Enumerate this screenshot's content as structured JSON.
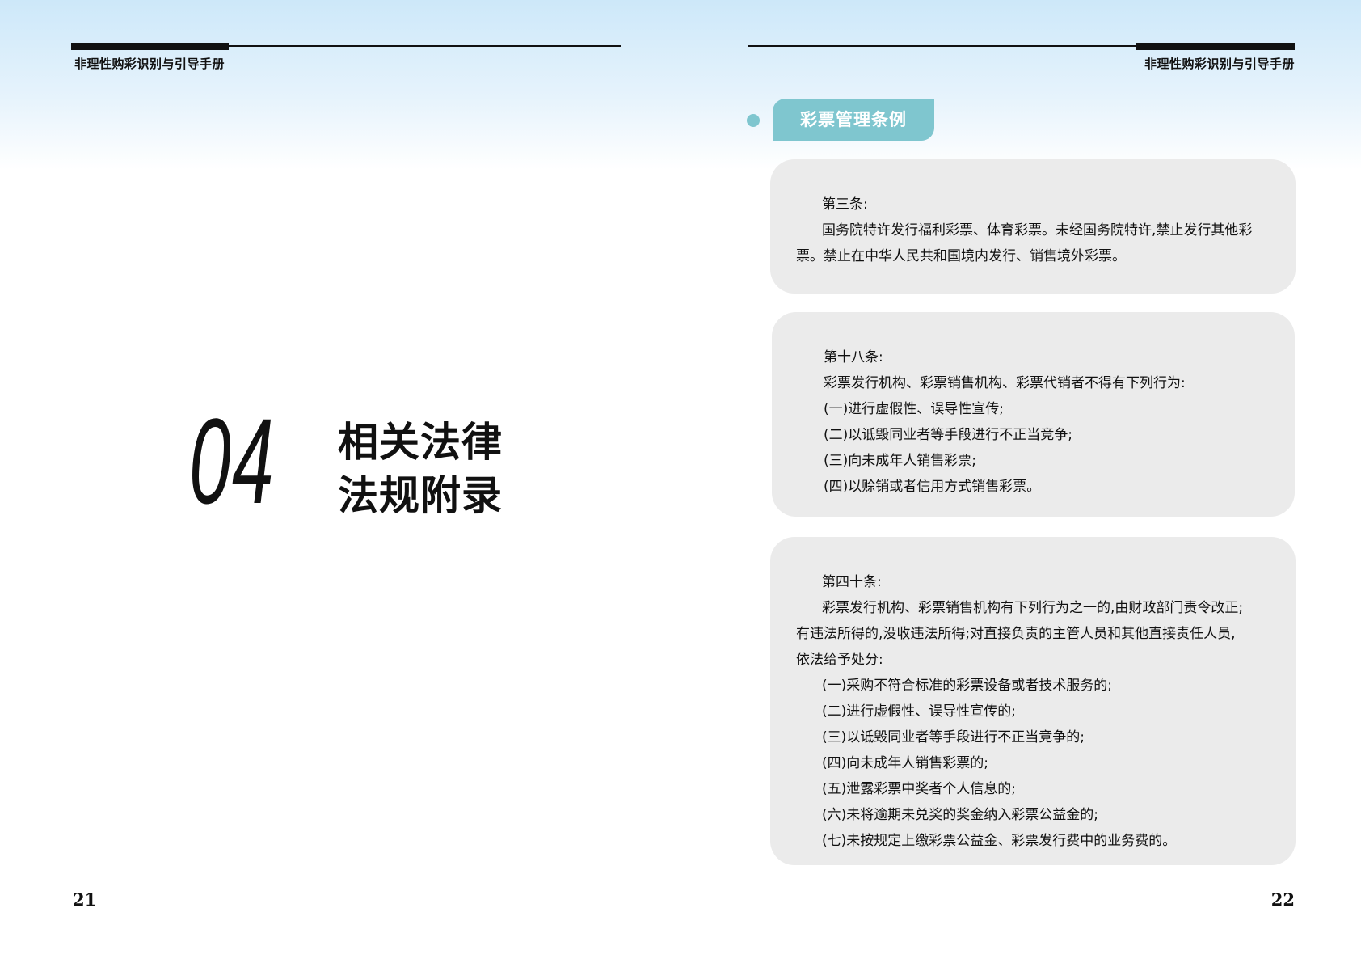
{
  "running_title": "非理性购彩识别与引导手册",
  "left_page": {
    "chapter_number": "04",
    "chapter_title_lines": [
      "相关法律",
      "法规附录"
    ],
    "page_number": "21"
  },
  "right_page": {
    "section_tag": "彩票管理条例",
    "page_number": "22",
    "articles": [
      {
        "heading": "第三条:",
        "lines": [
          "国务院特许发行福利彩票、体育彩票。未经国务院特许,禁止发行其他彩",
          "票。禁止在中华人民共和国境内发行、销售境外彩票。"
        ]
      },
      {
        "heading": "第十八条:",
        "lines": [
          "彩票发行机构、彩票销售机构、彩票代销者不得有下列行为:",
          "(一)进行虚假性、误导性宣传;",
          "(二)以诋毁同业者等手段进行不正当竞争;",
          "(三)向未成年人销售彩票;",
          "(四)以赊销或者信用方式销售彩票。"
        ]
      },
      {
        "heading": "第四十条:",
        "lines": [
          "彩票发行机构、彩票销售机构有下列行为之一的,由财政部门责令改正;",
          "有违法所得的,没收违法所得;对直接负责的主管人员和其他直接责任人员,",
          "依法给予处分:",
          "(一)采购不符合标准的彩票设备或者技术服务的;",
          "(二)进行虚假性、误导性宣传的;",
          "(三)以诋毁同业者等手段进行不正当竞争的;",
          "(四)向未成年人销售彩票的;",
          "(五)泄露彩票中奖者个人信息的;",
          "(六)未将逾期未兑奖的奖金纳入彩票公益金的;",
          "(七)未按规定上缴彩票公益金、彩票发行费中的业务费的。"
        ]
      }
    ]
  }
}
